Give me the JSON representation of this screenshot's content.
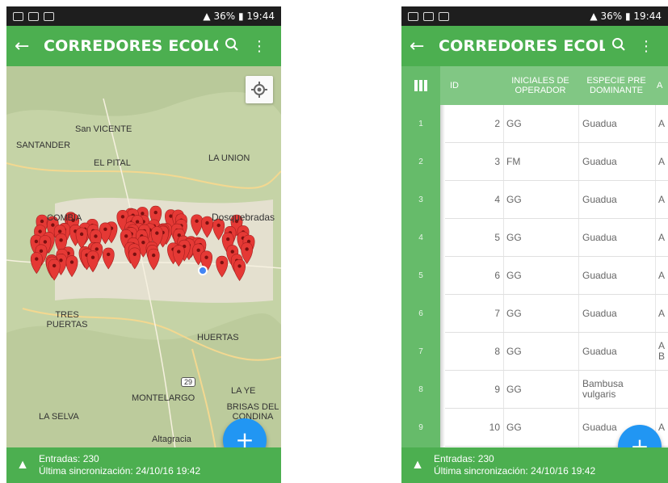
{
  "left_screen": {
    "status": {
      "battery": "36%",
      "time": "19:44"
    },
    "title": "CORREDORES ECOLO...",
    "map_labels": [
      "San VICENTE",
      "SANTANDER",
      "EL PITAL",
      "LA UNION",
      "COMBIA",
      "Dosquebradas",
      "TRES PUERTAS",
      "HUERTAS",
      "MONTELARGO",
      "LA YE",
      "BRISAS DEL CONDINA",
      "LA SELVA",
      "Altagracia",
      "29"
    ],
    "footer": {
      "entries": "Entradas: 230",
      "sync": "Última sincronización: 24/10/16 19:42"
    },
    "fab_label": "+"
  },
  "right_screen": {
    "status": {
      "battery": "36%",
      "time": "19:44"
    },
    "title": "CORREDORES ECOLO...",
    "columns": [
      "ID",
      "INICIALES DE OPERADOR",
      "ESPECIE PRE DOMINANTE",
      "A"
    ],
    "rows": [
      {
        "num": "1",
        "id": "2",
        "op": "GG",
        "sp": "Guadua",
        "a": "A"
      },
      {
        "num": "2",
        "id": "3",
        "op": "FM",
        "sp": "Guadua",
        "a": "A"
      },
      {
        "num": "3",
        "id": "4",
        "op": "GG",
        "sp": "Guadua",
        "a": "A"
      },
      {
        "num": "4",
        "id": "5",
        "op": "GG",
        "sp": "Guadua",
        "a": "A"
      },
      {
        "num": "5",
        "id": "6",
        "op": "GG",
        "sp": "Guadua",
        "a": "A"
      },
      {
        "num": "6",
        "id": "7",
        "op": "GG",
        "sp": "Guadua",
        "a": "A"
      },
      {
        "num": "7",
        "id": "8",
        "op": "GG",
        "sp": "Guadua",
        "a": "A B"
      },
      {
        "num": "8",
        "id": "9",
        "op": "GG",
        "sp": "Bambusa vulgaris",
        "a": ""
      },
      {
        "num": "9",
        "id": "10",
        "op": "GG",
        "sp": "Guadua",
        "a": "A"
      }
    ],
    "footer": {
      "entries": "Entradas: 230",
      "sync": "Última sincronización: 24/10/16 19:42"
    },
    "fab_label": "+"
  },
  "colors": {
    "primary": "#4caf50",
    "header": "#81c784",
    "sidebar": "#66bb6a",
    "fab": "#2196f3",
    "marker": "#e53935"
  },
  "icons": [
    "back-arrow-icon",
    "search-icon",
    "more-vert-icon",
    "my-location-icon",
    "grid-icon",
    "drive-icon",
    "plus-icon",
    "map-marker-icon"
  ]
}
